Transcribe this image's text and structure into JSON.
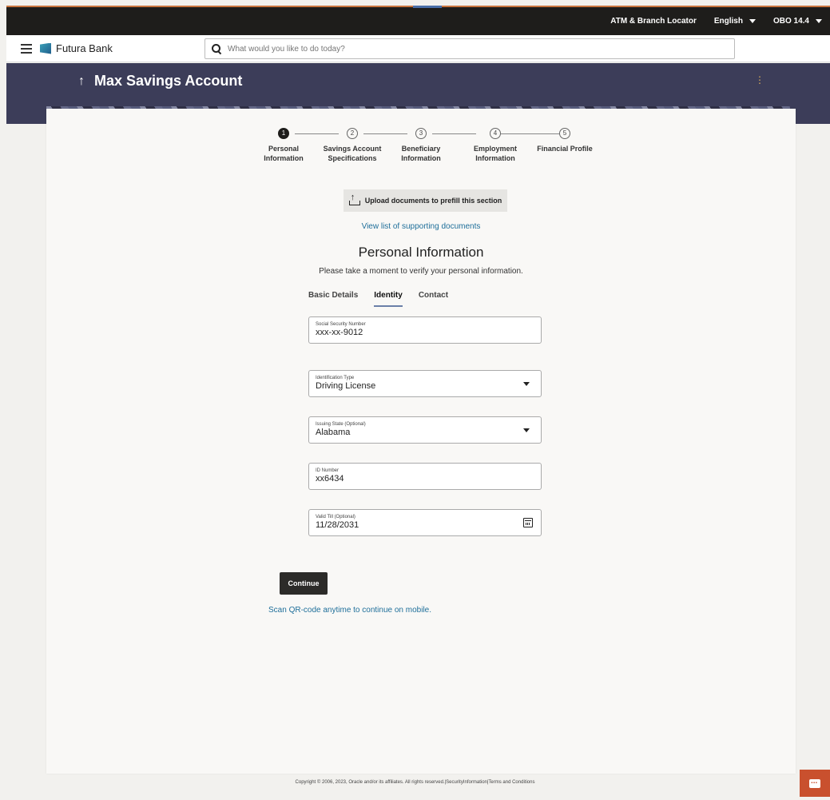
{
  "topbar": {
    "locator": "ATM & Branch Locator",
    "language": "English",
    "version": "OBO 14.4"
  },
  "header": {
    "brand": "Futura Bank",
    "search_placeholder": "What would you like to do today?"
  },
  "banner": {
    "title": "Max Savings Account",
    "back_arrow": "↑",
    "menu_glyph": "⋮"
  },
  "stepper": [
    {
      "num": "1",
      "line1": "Personal",
      "line2": "Information",
      "active": true
    },
    {
      "num": "2",
      "line1": "Savings Account",
      "line2": "Specifications",
      "active": false
    },
    {
      "num": "3",
      "line1": "Beneficiary",
      "line2": "Information",
      "active": false
    },
    {
      "num": "4",
      "line1": "Employment",
      "line2": "Information",
      "active": false
    },
    {
      "num": "5",
      "line1": "Financial Profile",
      "line2": "",
      "active": false
    }
  ],
  "upload": {
    "label": "Upload documents to prefill this section"
  },
  "docs_link": "View list of supporting documents",
  "section": {
    "title": "Personal Information",
    "subtitle": "Please take a moment to verify your personal information."
  },
  "tabs": [
    {
      "label": "Basic Details",
      "active": false
    },
    {
      "label": "Identity",
      "active": true
    },
    {
      "label": "Contact",
      "active": false
    }
  ],
  "fields": {
    "ssn": {
      "label": "Social Security Number",
      "value": "xxx-xx-9012"
    },
    "id_type": {
      "label": "Identification Type",
      "value": "Driving License"
    },
    "issuing_state": {
      "label": "Issuing State (Optional)",
      "value": "Alabama"
    },
    "id_number": {
      "label": "ID Number",
      "value": "xx6434"
    },
    "valid_till": {
      "label": "Valid Till (Optional)",
      "value": "11/28/2031"
    }
  },
  "actions": {
    "continue": "Continue",
    "qr_link": "Scan QR-code anytime to continue on mobile."
  },
  "footer": {
    "text": "Copyright © 2006, 2023, Oracle and/or its affiliates. All rights reserved.|SecurityInformation|Terms and Conditions"
  },
  "colors": {
    "topbar": "#1e1d1b",
    "banner": "#3c3d59",
    "link": "#1f6f9a",
    "chat": "#c9502e",
    "button": "#2c2b29"
  }
}
